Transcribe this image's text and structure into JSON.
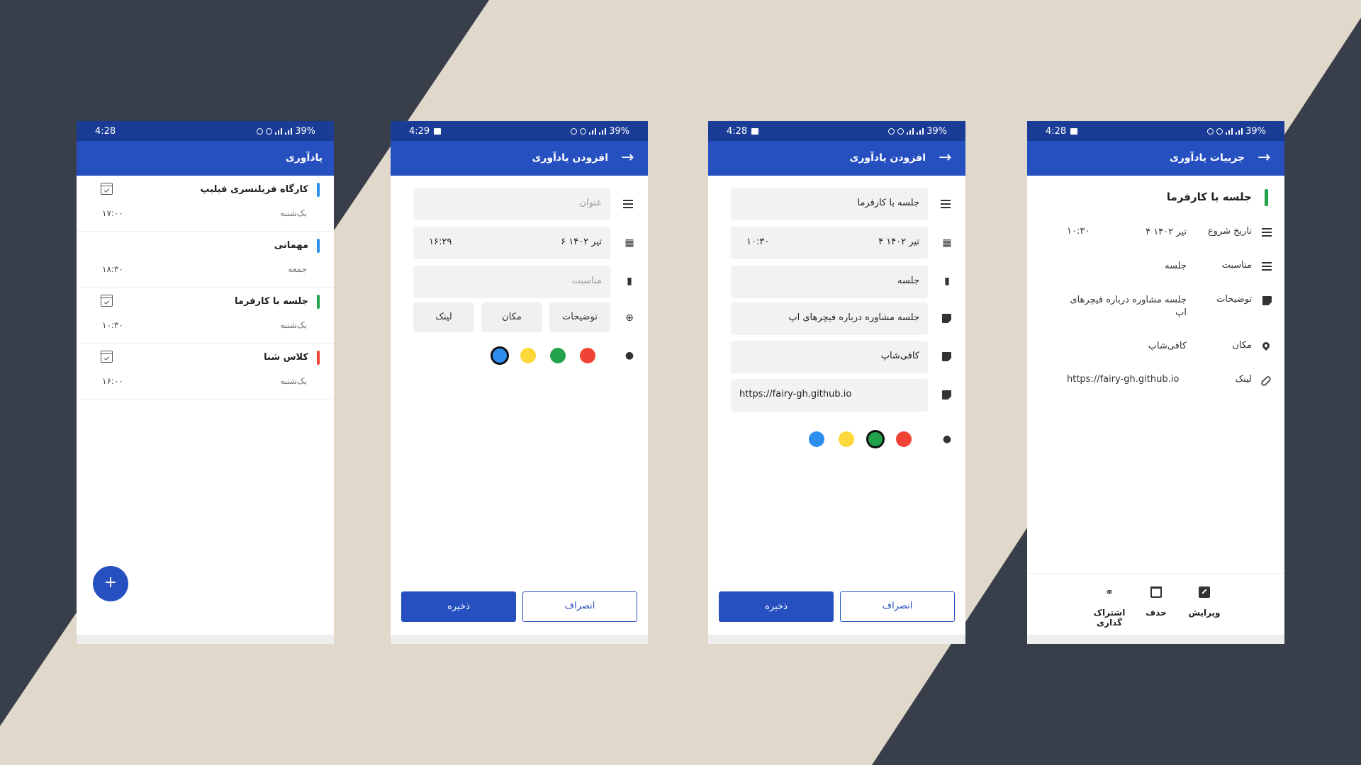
{
  "colors": {
    "dark_bg": "#383f4b",
    "cream_bg": "#e0d8ca",
    "status_bar": "#1a3c96",
    "app_bar": "#2650c0",
    "blue": "#2e8ef0",
    "yellow": "#fdd83b",
    "green": "#22a24a",
    "red": "#f04336"
  },
  "screens": {
    "list": {
      "status_time": "4:28",
      "battery": "39%",
      "title": "یادآوری",
      "items": [
        {
          "title": "کارگاه فریلنسری فیلیپ",
          "day": "یک‌شنبه",
          "time": "۱۷:۰۰",
          "color": "#2e8ef0",
          "icon": "calendar-check-icon"
        },
        {
          "title": "مهمانی",
          "day": "جمعه",
          "time": "۱۸:۳۰",
          "color": "#2e8ef0",
          "icon": ""
        },
        {
          "title": "جلسه با کارفرما",
          "day": "یک‌شنبه",
          "time": "۱۰:۳۰",
          "color": "#22a24a",
          "icon": "calendar-check-icon"
        },
        {
          "title": "کلاس شنا",
          "day": "یک‌شنبه",
          "time": "۱۶:۰۰",
          "color": "#f04336",
          "icon": "calendar-check-icon"
        }
      ],
      "fab": "+"
    },
    "add_empty": {
      "status_time": "4:29",
      "battery": "39%",
      "title": "افزودن یادآوری",
      "title_placeholder": "عنوان",
      "date": "۶ تیر ۱۴۰۲",
      "time": "۱۶:۲۹",
      "occasion_placeholder": "مناسبت",
      "chips": [
        "توضیحات",
        "مکان",
        "لینک"
      ],
      "selected_color": "#2e8ef0",
      "save": "ذخیره",
      "cancel": "انصراف"
    },
    "add_filled": {
      "status_time": "4:28",
      "battery": "39%",
      "title": "افزودن یادآوری",
      "title_value": "جلسه با کارفرما",
      "date": "۴ تیر ۱۴۰۲",
      "time": "۱۰:۳۰",
      "occasion": "جلسه",
      "description": "جلسه مشاوره درباره فیچرهای اپ",
      "location": "کافی‌شاپ",
      "link": "https://fairy-gh.github.io",
      "selected_color": "#22a24a",
      "save": "ذخیره",
      "cancel": "انصراف"
    },
    "details": {
      "status_time": "4:28",
      "battery": "39%",
      "title": "جزییات یادآوری",
      "reminder_title": "جلسه با کارفرما",
      "rows": {
        "start_label": "تاریخ شروع",
        "start_date": "۴ تیر ۱۴۰۲",
        "start_time": "۱۰:۳۰",
        "occasion_label": "مناسبت",
        "occasion": "جلسه",
        "desc_label": "توضیحات",
        "desc": "جلسه مشاوره درباره فیچرهای اپ",
        "location_label": "مکان",
        "location": "کافی‌شاپ",
        "link_label": "لینک",
        "link": "https://fairy-gh.github.io"
      },
      "actions": {
        "edit": "ویرایش",
        "delete": "حذف",
        "share": "اشتراک گذاری"
      }
    }
  }
}
